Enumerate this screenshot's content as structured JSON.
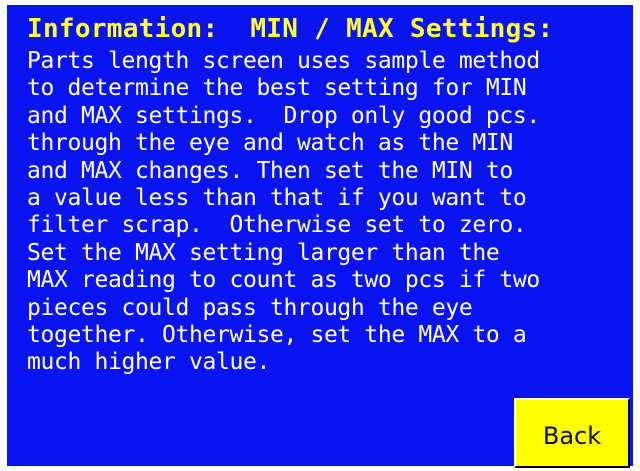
{
  "header": {
    "title": "Information:  MIN / MAX Settings:"
  },
  "body": {
    "lines": [
      "Parts length screen uses sample method",
      "to determine the best setting for MIN",
      "and MAX settings.  Drop only good pcs.",
      "through the eye and watch as the MIN",
      "and MAX changes. Then set the MIN to",
      "a value less than that if you want to",
      "filter scrap.  Otherwise set to zero.",
      "Set the MAX setting larger than the",
      "MAX reading to count as two pcs if two",
      "pieces could pass through the eye",
      "together. Otherwise, set the MAX to a",
      "much higher value."
    ]
  },
  "buttons": {
    "back_label": "Back"
  },
  "colors": {
    "panel_background": "#0a14f2",
    "title_text": "#ffff33",
    "body_text": "#ffffff",
    "button_background": "#ffff00"
  }
}
